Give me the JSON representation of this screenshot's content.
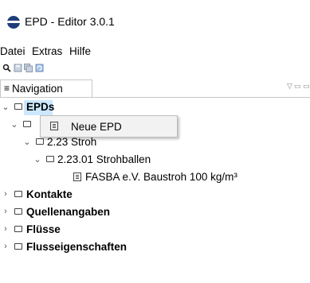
{
  "window": {
    "title": "EPD - Editor 3.0.1",
    "icon": "app-logo-icon"
  },
  "menubar": {
    "items": [
      "Datei",
      "Extras",
      "Hilfe"
    ]
  },
  "toolbar": {
    "icons": [
      "search-icon",
      "save-icon",
      "save-all-icon",
      "refresh-icon"
    ]
  },
  "panel": {
    "tab_label": "Navigation",
    "controls": [
      "minimize-icon",
      "maximize-icon"
    ]
  },
  "tree": {
    "root": "EPDs",
    "collapsed_label": "",
    "subfolder": "2.23 Stroh",
    "subsubfolder": "2.23.01 Strohballen",
    "item": "FASBA e.V. Baustroh 100 kg/m³",
    "roots": [
      "Kontakte",
      "Quellenangaben",
      "Flüsse",
      "Flusseigenschaften"
    ]
  },
  "context_menu": {
    "items": [
      "Neue EPD"
    ]
  },
  "colors": {
    "selection": "#cce8ff",
    "menu_bg": "#f2f2f2"
  }
}
